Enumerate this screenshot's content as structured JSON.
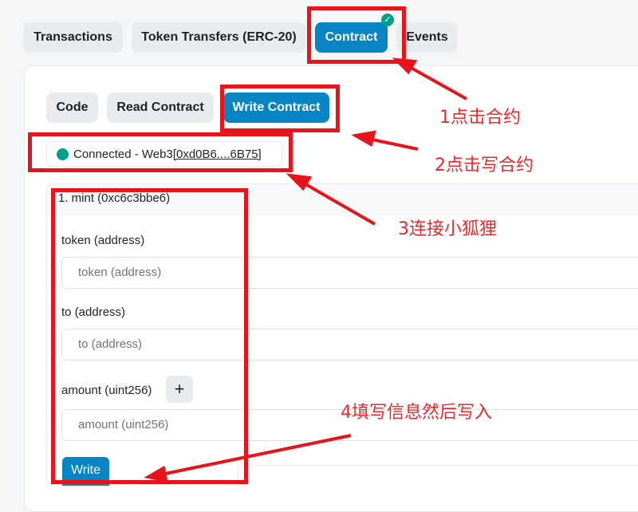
{
  "tabs": {
    "transactions": "Transactions",
    "token_transfers": "Token Transfers (ERC-20)",
    "contract": "Contract",
    "events": "Events"
  },
  "subtabs": {
    "code": "Code",
    "read": "Read Contract",
    "write": "Write Contract"
  },
  "connection": {
    "text": "Connected - Web3 ",
    "address": "[0xd0B6....6B75]",
    "status_color": "#00a186"
  },
  "method": {
    "header": "1. mint (0xc6c3bbe6)",
    "fields": [
      {
        "label": "token (address)",
        "placeholder": "token (address)"
      },
      {
        "label": "to (address)",
        "placeholder": "to (address)"
      },
      {
        "label": "amount (uint256)",
        "placeholder": "amount (uint256)"
      }
    ],
    "plus_label": "+",
    "write_label": "Write"
  },
  "annotations": {
    "step1": "1点击合约",
    "step2": "2点击写合约",
    "step3": "3连接小狐狸",
    "step4": "4填写信息然后写入",
    "color": "#e8141b"
  },
  "colors": {
    "primary": "#0784c3",
    "success": "#00a186"
  }
}
